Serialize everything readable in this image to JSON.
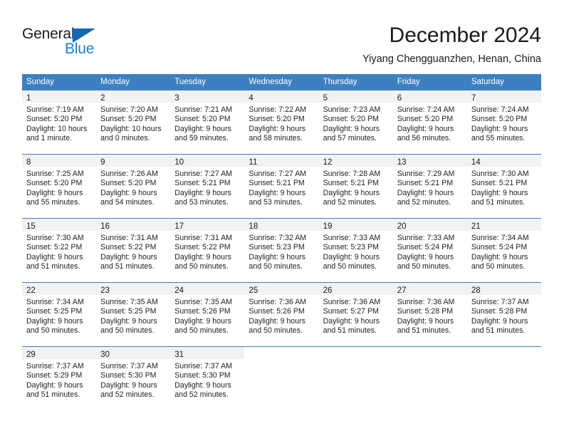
{
  "brand": {
    "name_part1": "General",
    "name_part2": "Blue"
  },
  "header": {
    "title": "December 2024",
    "subtitle": "Yiyang Chengguanzhen, Henan, China"
  },
  "colors": {
    "header_blue": "#3d80c2",
    "brand_blue": "#1b7fd4",
    "logo_triangle": "#1268b3",
    "daynum_band": "#f2f2f2",
    "text": "#222222"
  },
  "weekdays": [
    "Sunday",
    "Monday",
    "Tuesday",
    "Wednesday",
    "Thursday",
    "Friday",
    "Saturday"
  ],
  "weeks": [
    [
      {
        "day": "1",
        "sunrise": "Sunrise: 7:19 AM",
        "sunset": "Sunset: 5:20 PM",
        "daylight1": "Daylight: 10 hours",
        "daylight2": "and 1 minute."
      },
      {
        "day": "2",
        "sunrise": "Sunrise: 7:20 AM",
        "sunset": "Sunset: 5:20 PM",
        "daylight1": "Daylight: 10 hours",
        "daylight2": "and 0 minutes."
      },
      {
        "day": "3",
        "sunrise": "Sunrise: 7:21 AM",
        "sunset": "Sunset: 5:20 PM",
        "daylight1": "Daylight: 9 hours",
        "daylight2": "and 59 minutes."
      },
      {
        "day": "4",
        "sunrise": "Sunrise: 7:22 AM",
        "sunset": "Sunset: 5:20 PM",
        "daylight1": "Daylight: 9 hours",
        "daylight2": "and 58 minutes."
      },
      {
        "day": "5",
        "sunrise": "Sunrise: 7:23 AM",
        "sunset": "Sunset: 5:20 PM",
        "daylight1": "Daylight: 9 hours",
        "daylight2": "and 57 minutes."
      },
      {
        "day": "6",
        "sunrise": "Sunrise: 7:24 AM",
        "sunset": "Sunset: 5:20 PM",
        "daylight1": "Daylight: 9 hours",
        "daylight2": "and 56 minutes."
      },
      {
        "day": "7",
        "sunrise": "Sunrise: 7:24 AM",
        "sunset": "Sunset: 5:20 PM",
        "daylight1": "Daylight: 9 hours",
        "daylight2": "and 55 minutes."
      }
    ],
    [
      {
        "day": "8",
        "sunrise": "Sunrise: 7:25 AM",
        "sunset": "Sunset: 5:20 PM",
        "daylight1": "Daylight: 9 hours",
        "daylight2": "and 55 minutes."
      },
      {
        "day": "9",
        "sunrise": "Sunrise: 7:26 AM",
        "sunset": "Sunset: 5:20 PM",
        "daylight1": "Daylight: 9 hours",
        "daylight2": "and 54 minutes."
      },
      {
        "day": "10",
        "sunrise": "Sunrise: 7:27 AM",
        "sunset": "Sunset: 5:21 PM",
        "daylight1": "Daylight: 9 hours",
        "daylight2": "and 53 minutes."
      },
      {
        "day": "11",
        "sunrise": "Sunrise: 7:27 AM",
        "sunset": "Sunset: 5:21 PM",
        "daylight1": "Daylight: 9 hours",
        "daylight2": "and 53 minutes."
      },
      {
        "day": "12",
        "sunrise": "Sunrise: 7:28 AM",
        "sunset": "Sunset: 5:21 PM",
        "daylight1": "Daylight: 9 hours",
        "daylight2": "and 52 minutes."
      },
      {
        "day": "13",
        "sunrise": "Sunrise: 7:29 AM",
        "sunset": "Sunset: 5:21 PM",
        "daylight1": "Daylight: 9 hours",
        "daylight2": "and 52 minutes."
      },
      {
        "day": "14",
        "sunrise": "Sunrise: 7:30 AM",
        "sunset": "Sunset: 5:21 PM",
        "daylight1": "Daylight: 9 hours",
        "daylight2": "and 51 minutes."
      }
    ],
    [
      {
        "day": "15",
        "sunrise": "Sunrise: 7:30 AM",
        "sunset": "Sunset: 5:22 PM",
        "daylight1": "Daylight: 9 hours",
        "daylight2": "and 51 minutes."
      },
      {
        "day": "16",
        "sunrise": "Sunrise: 7:31 AM",
        "sunset": "Sunset: 5:22 PM",
        "daylight1": "Daylight: 9 hours",
        "daylight2": "and 51 minutes."
      },
      {
        "day": "17",
        "sunrise": "Sunrise: 7:31 AM",
        "sunset": "Sunset: 5:22 PM",
        "daylight1": "Daylight: 9 hours",
        "daylight2": "and 50 minutes."
      },
      {
        "day": "18",
        "sunrise": "Sunrise: 7:32 AM",
        "sunset": "Sunset: 5:23 PM",
        "daylight1": "Daylight: 9 hours",
        "daylight2": "and 50 minutes."
      },
      {
        "day": "19",
        "sunrise": "Sunrise: 7:33 AM",
        "sunset": "Sunset: 5:23 PM",
        "daylight1": "Daylight: 9 hours",
        "daylight2": "and 50 minutes."
      },
      {
        "day": "20",
        "sunrise": "Sunrise: 7:33 AM",
        "sunset": "Sunset: 5:24 PM",
        "daylight1": "Daylight: 9 hours",
        "daylight2": "and 50 minutes."
      },
      {
        "day": "21",
        "sunrise": "Sunrise: 7:34 AM",
        "sunset": "Sunset: 5:24 PM",
        "daylight1": "Daylight: 9 hours",
        "daylight2": "and 50 minutes."
      }
    ],
    [
      {
        "day": "22",
        "sunrise": "Sunrise: 7:34 AM",
        "sunset": "Sunset: 5:25 PM",
        "daylight1": "Daylight: 9 hours",
        "daylight2": "and 50 minutes."
      },
      {
        "day": "23",
        "sunrise": "Sunrise: 7:35 AM",
        "sunset": "Sunset: 5:25 PM",
        "daylight1": "Daylight: 9 hours",
        "daylight2": "and 50 minutes."
      },
      {
        "day": "24",
        "sunrise": "Sunrise: 7:35 AM",
        "sunset": "Sunset: 5:26 PM",
        "daylight1": "Daylight: 9 hours",
        "daylight2": "and 50 minutes."
      },
      {
        "day": "25",
        "sunrise": "Sunrise: 7:36 AM",
        "sunset": "Sunset: 5:26 PM",
        "daylight1": "Daylight: 9 hours",
        "daylight2": "and 50 minutes."
      },
      {
        "day": "26",
        "sunrise": "Sunrise: 7:36 AM",
        "sunset": "Sunset: 5:27 PM",
        "daylight1": "Daylight: 9 hours",
        "daylight2": "and 51 minutes."
      },
      {
        "day": "27",
        "sunrise": "Sunrise: 7:36 AM",
        "sunset": "Sunset: 5:28 PM",
        "daylight1": "Daylight: 9 hours",
        "daylight2": "and 51 minutes."
      },
      {
        "day": "28",
        "sunrise": "Sunrise: 7:37 AM",
        "sunset": "Sunset: 5:28 PM",
        "daylight1": "Daylight: 9 hours",
        "daylight2": "and 51 minutes."
      }
    ],
    [
      {
        "day": "29",
        "sunrise": "Sunrise: 7:37 AM",
        "sunset": "Sunset: 5:29 PM",
        "daylight1": "Daylight: 9 hours",
        "daylight2": "and 51 minutes."
      },
      {
        "day": "30",
        "sunrise": "Sunrise: 7:37 AM",
        "sunset": "Sunset: 5:30 PM",
        "daylight1": "Daylight: 9 hours",
        "daylight2": "and 52 minutes."
      },
      {
        "day": "31",
        "sunrise": "Sunrise: 7:37 AM",
        "sunset": "Sunset: 5:30 PM",
        "daylight1": "Daylight: 9 hours",
        "daylight2": "and 52 minutes."
      },
      {
        "day": "",
        "sunrise": "",
        "sunset": "",
        "daylight1": "",
        "daylight2": ""
      },
      {
        "day": "",
        "sunrise": "",
        "sunset": "",
        "daylight1": "",
        "daylight2": ""
      },
      {
        "day": "",
        "sunrise": "",
        "sunset": "",
        "daylight1": "",
        "daylight2": ""
      },
      {
        "day": "",
        "sunrise": "",
        "sunset": "",
        "daylight1": "",
        "daylight2": ""
      }
    ]
  ]
}
